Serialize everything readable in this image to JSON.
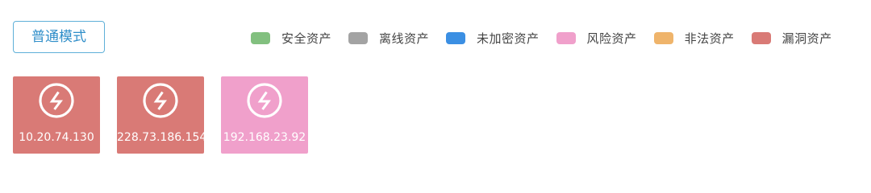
{
  "mode_button": {
    "label": "普通模式"
  },
  "legend": [
    {
      "label": "安全资产",
      "color": "#82c07f"
    },
    {
      "label": "离线资产",
      "color": "#a3a3a3"
    },
    {
      "label": "未加密资产",
      "color": "#3b8fe3"
    },
    {
      "label": "风险资产",
      "color": "#f0a0cb"
    },
    {
      "label": "非法资产",
      "color": "#efb46b"
    },
    {
      "label": "漏洞资产",
      "color": "#d97a76"
    }
  ],
  "assets": [
    {
      "ip": "10.20.74.130",
      "color": "#d97a76",
      "icon": "lightning-icon"
    },
    {
      "ip": "228.73.186.154",
      "color": "#d97a76",
      "icon": "lightning-icon"
    },
    {
      "ip": "192.168.23.92",
      "color": "#f0a0cb",
      "icon": "lightning-icon"
    }
  ]
}
